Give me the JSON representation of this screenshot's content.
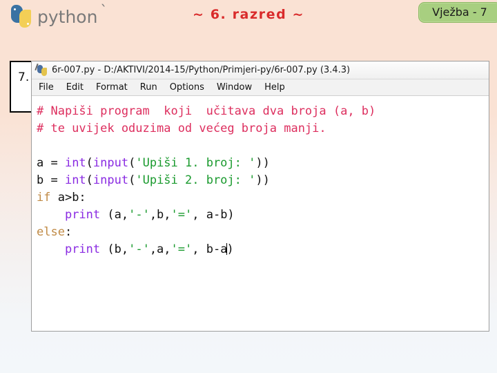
{
  "header": {
    "logo_text": "python",
    "logo_tick": "`",
    "logo_icon": "python-logo-icon",
    "title": "~ 6. razred ~",
    "badge_label": "Vježba - 7",
    "badge_color": "#a8cf80",
    "title_color": "#d92b2b"
  },
  "item": {
    "number": "7."
  },
  "idle": {
    "app_icon": "idle-python-file-icon",
    "window_title": "6r-007.py - D:/AKTIVI/2014-15/Python/Primjeri-py/6r-007.py (3.4.3)",
    "menu": [
      "File",
      "Edit",
      "Format",
      "Run",
      "Options",
      "Window",
      "Help"
    ],
    "code_lines": [
      {
        "tokens": [
          {
            "t": "# Napiši program  koji  učitava dva broja (a, b)",
            "c": "comment"
          }
        ]
      },
      {
        "tokens": [
          {
            "t": "# te uvijek oduzima od većeg broja manji.",
            "c": "comment"
          }
        ]
      },
      {
        "tokens": []
      },
      {
        "tokens": [
          {
            "t": "a = ",
            "c": "plain"
          },
          {
            "t": "int",
            "c": "builtin"
          },
          {
            "t": "(",
            "c": "plain"
          },
          {
            "t": "input",
            "c": "builtin"
          },
          {
            "t": "(",
            "c": "plain"
          },
          {
            "t": "'Upiši 1. broj: '",
            "c": "string"
          },
          {
            "t": "))",
            "c": "plain"
          }
        ]
      },
      {
        "tokens": [
          {
            "t": "b = ",
            "c": "plain"
          },
          {
            "t": "int",
            "c": "builtin"
          },
          {
            "t": "(",
            "c": "plain"
          },
          {
            "t": "input",
            "c": "builtin"
          },
          {
            "t": "(",
            "c": "plain"
          },
          {
            "t": "'Upiši 2. broj: '",
            "c": "string"
          },
          {
            "t": "))",
            "c": "plain"
          }
        ]
      },
      {
        "tokens": [
          {
            "t": "if",
            "c": "keyword"
          },
          {
            "t": " a>b:",
            "c": "plain"
          }
        ]
      },
      {
        "tokens": [
          {
            "t": "    ",
            "c": "plain"
          },
          {
            "t": "print",
            "c": "builtin"
          },
          {
            "t": " (a,",
            "c": "plain"
          },
          {
            "t": "'-'",
            "c": "string"
          },
          {
            "t": ",b,",
            "c": "plain"
          },
          {
            "t": "'='",
            "c": "string"
          },
          {
            "t": ", a-b)",
            "c": "plain"
          }
        ]
      },
      {
        "tokens": [
          {
            "t": "else",
            "c": "keyword"
          },
          {
            "t": ":",
            "c": "plain"
          }
        ]
      },
      {
        "tokens": [
          {
            "t": "    ",
            "c": "plain"
          },
          {
            "t": "print",
            "c": "builtin"
          },
          {
            "t": " (b,",
            "c": "plain"
          },
          {
            "t": "'-'",
            "c": "string"
          },
          {
            "t": ",a,",
            "c": "plain"
          },
          {
            "t": "'='",
            "c": "string"
          },
          {
            "t": ", b-a",
            "c": "plain"
          },
          {
            "t": "",
            "c": "caret"
          },
          {
            "t": ")",
            "c": "plain"
          }
        ]
      }
    ]
  }
}
